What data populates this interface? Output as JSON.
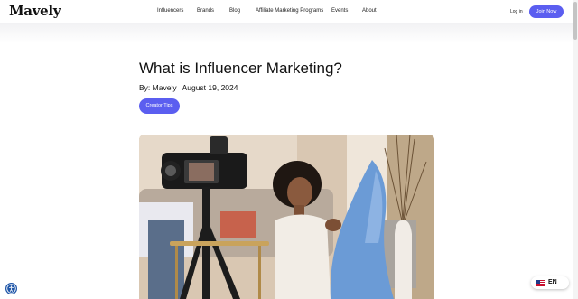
{
  "header": {
    "logo": "Mavely",
    "nav": [
      "Influencers",
      "Brands",
      "Blog",
      "Affiliate Marketing Programs",
      "Events",
      "About"
    ],
    "login": "Log in",
    "join": "Join Now"
  },
  "article": {
    "title": "What is Influencer Marketing?",
    "author": "By: Mavely",
    "date": "August 19, 2024",
    "tag": "Creator Tips"
  },
  "language": {
    "code": "EN"
  },
  "colors": {
    "accent": "#5b5ef0",
    "accessibility": "#1f56a8"
  },
  "icons": [
    "accessibility-icon",
    "us-flag-icon"
  ]
}
